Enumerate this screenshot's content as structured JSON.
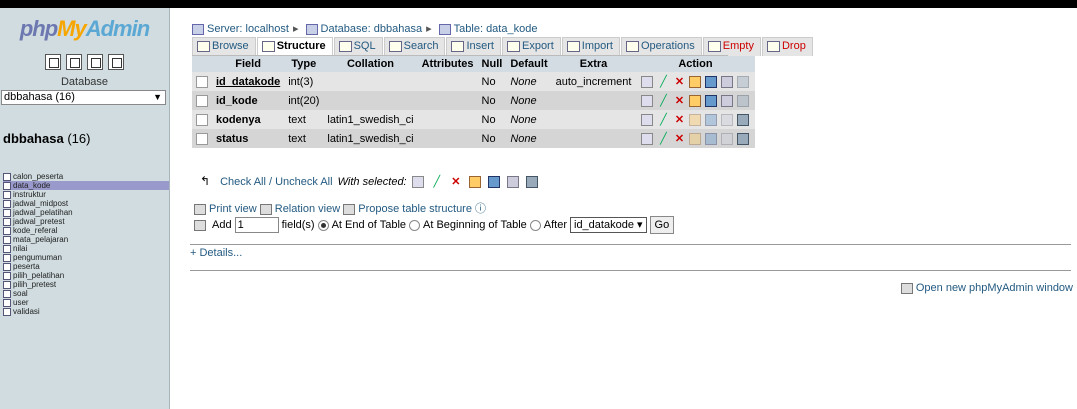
{
  "logo": {
    "php": "php",
    "my": "My",
    "admin": "Admin"
  },
  "left": {
    "nav_icons": [
      "home-icon",
      "query-icon",
      "docs-icon",
      "reload-icon"
    ],
    "database_label": "Database",
    "database_select": "dbbahasa (16)",
    "db_title_name": "dbbahasa",
    "db_title_count": "(16)",
    "tables": [
      "calon_peserta",
      "data_kode",
      "instruktur",
      "jadwal_midpost",
      "jadwal_pelatihan",
      "jadwal_pretest",
      "kode_referal",
      "mata_pelajaran",
      "nilai",
      "pengumuman",
      "peserta",
      "pilih_pelatihan",
      "pilih_pretest",
      "soal",
      "user",
      "validasi"
    ],
    "active_table": "data_kode"
  },
  "breadcrumb": {
    "server": "Server: localhost",
    "database": "Database: dbbahasa",
    "table": "Table: data_kode"
  },
  "tabs": [
    {
      "label": "Browse",
      "icon": "browse-icon"
    },
    {
      "label": "Structure",
      "icon": "structure-icon",
      "active": true
    },
    {
      "label": "SQL",
      "icon": "sql-icon"
    },
    {
      "label": "Search",
      "icon": "search-icon"
    },
    {
      "label": "Insert",
      "icon": "insert-icon"
    },
    {
      "label": "Export",
      "icon": "export-icon"
    },
    {
      "label": "Import",
      "icon": "import-icon"
    },
    {
      "label": "Operations",
      "icon": "operations-icon"
    },
    {
      "label": "Empty",
      "icon": "empty-icon"
    },
    {
      "label": "Drop",
      "icon": "drop-icon"
    }
  ],
  "table": {
    "headers": [
      "Field",
      "Type",
      "Collation",
      "Attributes",
      "Null",
      "Default",
      "Extra",
      "Action"
    ],
    "rows": [
      {
        "field": "id_datakode",
        "type": "int(3)",
        "collation": "",
        "attributes": "",
        "null": "No",
        "default": "None",
        "extra": "auto_increment"
      },
      {
        "field": "id_kode",
        "type": "int(20)",
        "collation": "",
        "attributes": "",
        "null": "No",
        "default": "None",
        "extra": ""
      },
      {
        "field": "kodenya",
        "type": "text",
        "collation": "latin1_swedish_ci",
        "attributes": "",
        "null": "No",
        "default": "None",
        "extra": ""
      },
      {
        "field": "status",
        "type": "text",
        "collation": "latin1_swedish_ci",
        "attributes": "",
        "null": "No",
        "default": "None",
        "extra": ""
      }
    ]
  },
  "checkall": {
    "link": "Check All / Uncheck All",
    "with_selected": "With selected:"
  },
  "links": {
    "print": "Print view",
    "relation": "Relation view",
    "propose": "Propose table structure"
  },
  "addrow": {
    "add_label": "Add",
    "count": "1",
    "fields_label": "field(s)",
    "end_label": "At End of Table",
    "begin_label": "At Beginning of Table",
    "after_label": "After",
    "after_value": "id_datakode",
    "go": "Go"
  },
  "details": "+ Details...",
  "new_window": "Open new phpMyAdmin window"
}
